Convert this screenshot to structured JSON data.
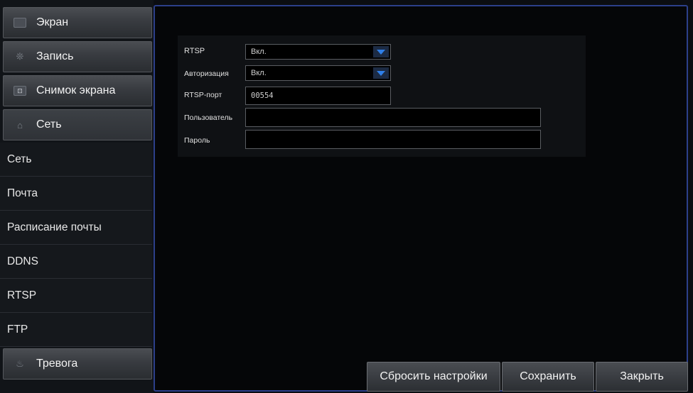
{
  "sidebar": {
    "categories": [
      {
        "label": "Экран",
        "icon": "monitor-icon"
      },
      {
        "label": "Запись",
        "icon": "record-icon"
      },
      {
        "label": "Снимок экрана",
        "icon": "snapshot-icon"
      },
      {
        "label": "Сеть",
        "icon": "network-icon"
      },
      {
        "label": "Тревога",
        "icon": "alarm-icon"
      }
    ],
    "subitems": [
      {
        "label": "Сеть"
      },
      {
        "label": "Почта"
      },
      {
        "label": "Расписание почты"
      },
      {
        "label": "DDNS"
      },
      {
        "label": "RTSP"
      },
      {
        "label": "FTP"
      }
    ]
  },
  "form": {
    "rtsp": {
      "label": "RTSP",
      "value": "Вкл."
    },
    "auth": {
      "label": "Авторизация",
      "value": "Вкл."
    },
    "port": {
      "label": "RTSP-порт",
      "value": "00554"
    },
    "user": {
      "label": "Пользователь",
      "value": ""
    },
    "password": {
      "label": "Пароль",
      "value": ""
    }
  },
  "buttons": {
    "reset": "Сбросить настройки",
    "save": "Сохранить",
    "close": "Закрыть"
  },
  "colors": {
    "accent_border": "#2c3f8a",
    "dropdown_arrow": "#2f7fe8"
  }
}
